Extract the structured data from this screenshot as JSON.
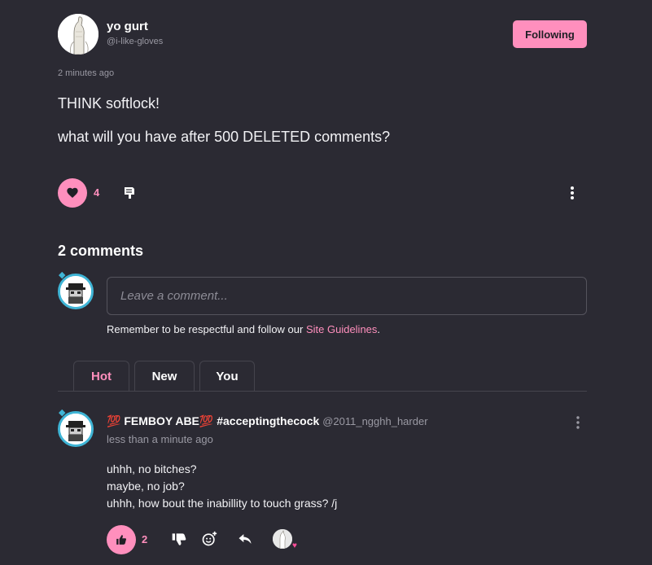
{
  "post": {
    "author_name": "yo gurt",
    "author_handle": "@i-like-gloves",
    "follow_label": "Following",
    "timestamp": "2 minutes ago",
    "line1": "THINK softlock!",
    "line2": "what will you have after 500 DELETED comments?",
    "like_count": "4"
  },
  "comments_section": {
    "heading": "2 comments",
    "input_placeholder": "Leave a comment...",
    "guidelines_prefix": "Remember to be respectful and follow our ",
    "guidelines_link": "Site Guidelines",
    "guidelines_suffix": ".",
    "tabs": [
      {
        "label": "Hot",
        "active": true
      },
      {
        "label": "New",
        "active": false
      },
      {
        "label": "You",
        "active": false
      }
    ]
  },
  "comment": {
    "author_emoji_left": "💯",
    "author_name": "FEMBOY ABE",
    "author_emoji_right": "💯",
    "author_tag": "#acceptingthecock",
    "author_handle": "@2011_ngghh_harder",
    "time": "less than a minute ago",
    "lines": [
      "uhhh, no bitches?",
      "maybe, no job?",
      "uhhh, how bout the inabillity to touch grass? /j"
    ],
    "like_count": "2"
  },
  "colors": {
    "background": "#2b2a33",
    "accent": "#ff8fbd",
    "muted_text": "#9a99a3",
    "avatar_ring": "#3fb5d6"
  },
  "icons": [
    "heart-icon",
    "dislike-icon",
    "more-vertical-icon",
    "thumbs-up-icon",
    "thumbs-down-icon",
    "add-reaction-icon",
    "reply-icon"
  ]
}
